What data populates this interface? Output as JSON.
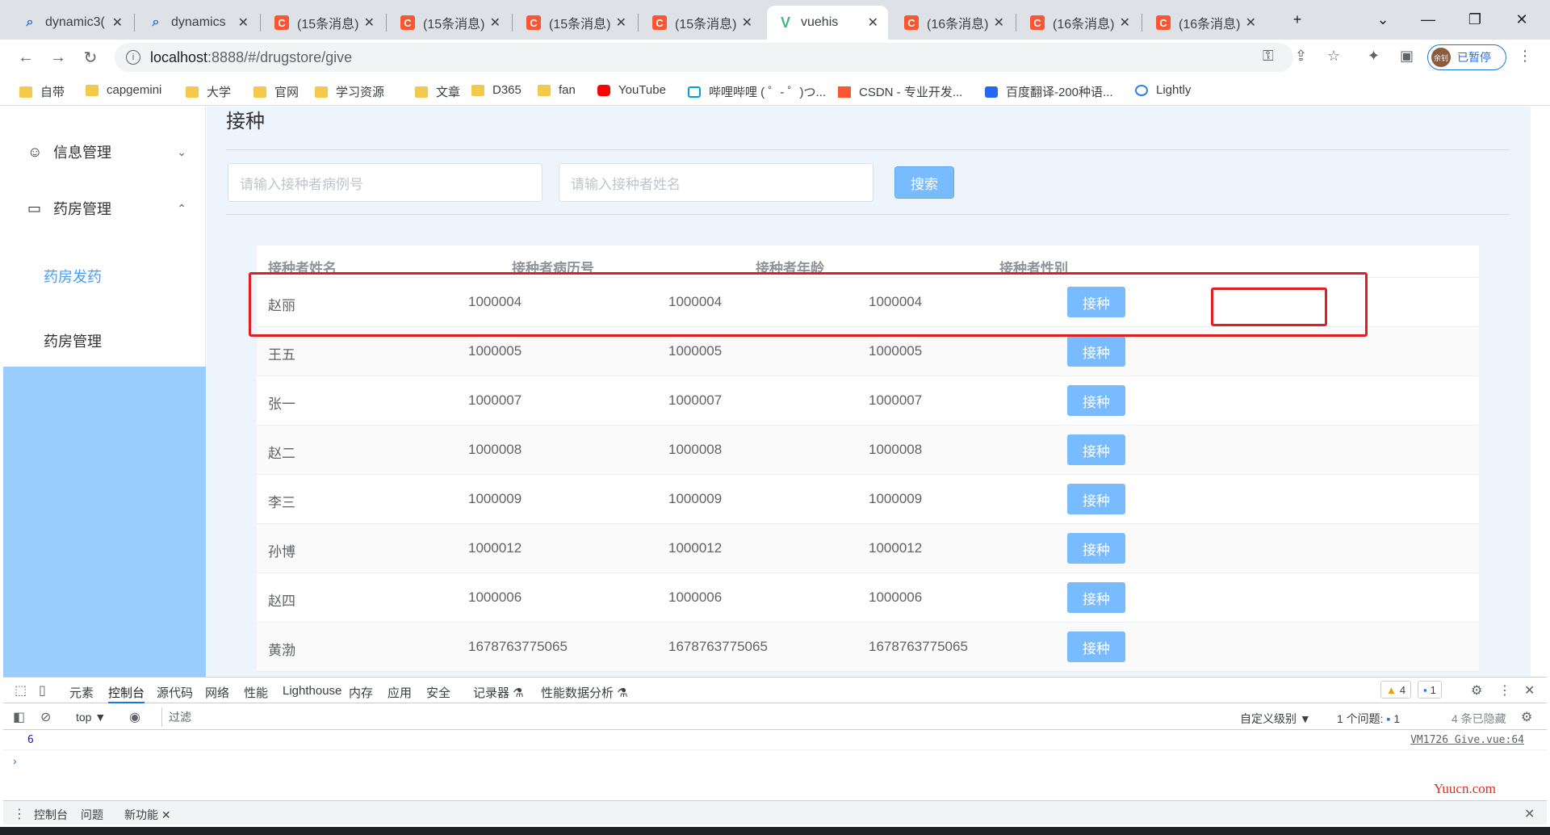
{
  "browser": {
    "tabs": [
      {
        "title": "dynamic3(",
        "icon": "search-icon"
      },
      {
        "title": "dynamics",
        "icon": "search-icon"
      },
      {
        "title": "(15条消息)",
        "icon": "csdn-icon"
      },
      {
        "title": "(15条消息)",
        "icon": "csdn-icon"
      },
      {
        "title": "(15条消息)",
        "icon": "csdn-icon"
      },
      {
        "title": "(15条消息)",
        "icon": "csdn-icon"
      },
      {
        "title": "vuehis",
        "icon": "vue-icon"
      },
      {
        "title": "(16条消息)",
        "icon": "csdn-icon"
      },
      {
        "title": "(16条消息)",
        "icon": "csdn-icon"
      },
      {
        "title": "(16条消息)",
        "icon": "csdn-icon"
      }
    ],
    "csdn_glyph": "C",
    "vue_glyph": "V",
    "url_host": "localhost",
    "url_rest": ":8888/#/drugstore/give",
    "profile_avatar": "余钊",
    "profile_label": "已暂停",
    "bookmarks": [
      {
        "label": "自带",
        "icon": "folder"
      },
      {
        "label": "capgemini",
        "icon": "folder"
      },
      {
        "label": "大学",
        "icon": "folder"
      },
      {
        "label": "官网",
        "icon": "folder"
      },
      {
        "label": "学习资源",
        "icon": "folder"
      },
      {
        "label": "文章",
        "icon": "folder"
      },
      {
        "label": "D365",
        "icon": "folder"
      },
      {
        "label": "fan",
        "icon": "folder"
      },
      {
        "label": "YouTube",
        "icon": "yt"
      },
      {
        "label": "哔哩哔哩 ( ゜- ゜)つ...",
        "icon": "bili"
      },
      {
        "label": "CSDN - 专业开发...",
        "icon": "csdn"
      },
      {
        "label": "百度翻译-200种语...",
        "icon": "baidu"
      },
      {
        "label": "Lightly",
        "icon": "lightly"
      }
    ]
  },
  "sidebar": {
    "menus": [
      {
        "label": "信息管理",
        "icon": "user-icon"
      },
      {
        "label": "药房管理",
        "icon": "folder-icon"
      }
    ],
    "subitems": [
      {
        "label": "药房发药",
        "active": true
      },
      {
        "label": "药房管理",
        "active": false
      }
    ]
  },
  "main": {
    "title": "接种",
    "search": {
      "case_placeholder": "请输入接种者病例号",
      "name_placeholder": "请输入接种者姓名",
      "button_label": "搜索"
    },
    "table": {
      "columns": [
        "接种者姓名",
        "接种者病历号",
        "接种者年龄",
        "接种者性别"
      ],
      "action_label": "接种",
      "rows": [
        [
          "赵丽",
          "1000004",
          "1000004",
          "1000004"
        ],
        [
          "王五",
          "1000005",
          "1000005",
          "1000005"
        ],
        [
          "张一",
          "1000007",
          "1000007",
          "1000007"
        ],
        [
          "赵二",
          "1000008",
          "1000008",
          "1000008"
        ],
        [
          "李三",
          "1000009",
          "1000009",
          "1000009"
        ],
        [
          "孙博",
          "1000012",
          "1000012",
          "1000012"
        ],
        [
          "赵四",
          "1000006",
          "1000006",
          "1000006"
        ],
        [
          "黄渤",
          "1678763775065",
          "1678763775065",
          "1678763775065"
        ]
      ]
    }
  },
  "devtools": {
    "tabs": [
      "元素",
      "控制台",
      "源代码",
      "网络",
      "性能",
      "Lighthouse",
      "内存",
      "应用",
      "安全",
      "记录器 ⚗",
      "性能数据分析 ⚗"
    ],
    "active_tab": "控制台",
    "warning_count": "4",
    "message_count": "1",
    "context": "top ▼",
    "filter_placeholder": "过滤",
    "level": "自定义级别 ▼",
    "issues": "1 个问题:",
    "issues_count": "1",
    "hidden": "4 条已隐藏",
    "log_value": "6",
    "log_source": "VM1726 Give.vue:64",
    "prompt": "›",
    "drawer_tabs": [
      "控制台",
      "问题",
      "新功能"
    ],
    "watermark": "Yuucn.com"
  }
}
